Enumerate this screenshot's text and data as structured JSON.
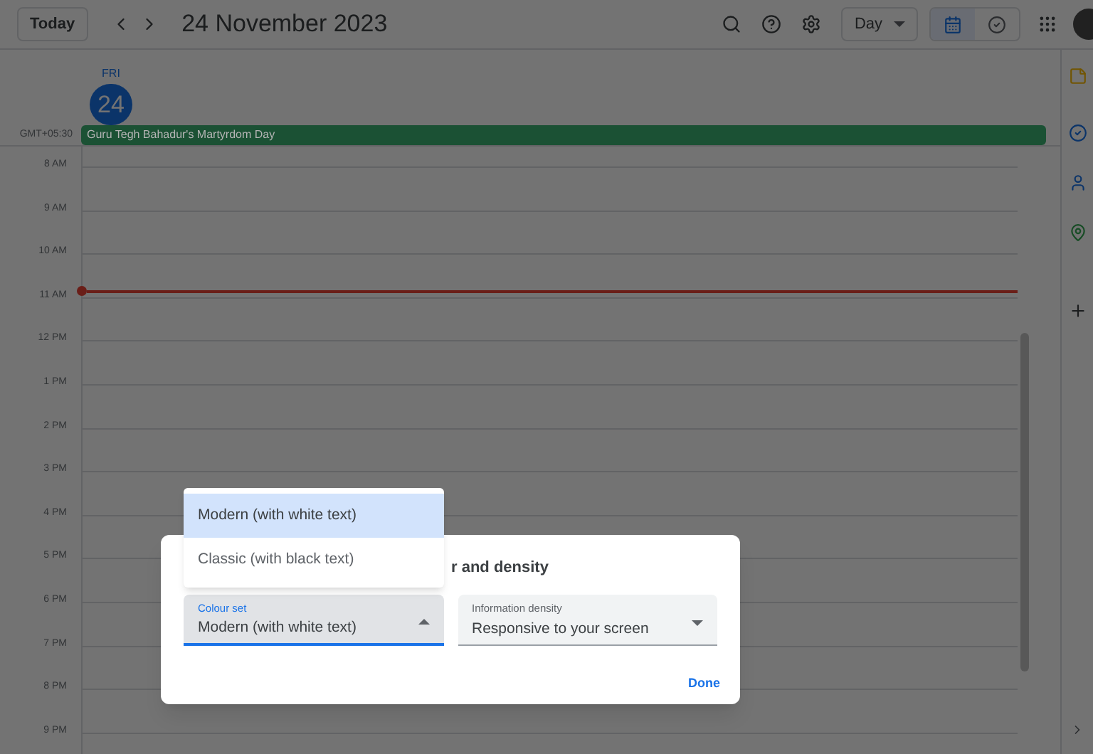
{
  "toolbar": {
    "today_button": "Today",
    "title": "24 November 2023",
    "view_dropdown": "Day",
    "view_toggle": [
      {
        "kind": "calendar",
        "selected": true
      },
      {
        "kind": "tasks",
        "selected": false
      }
    ]
  },
  "day_header": {
    "weekday": "FRI",
    "date": "24",
    "today": true
  },
  "all_day": {
    "timezone": "GMT+05:30",
    "events": [
      {
        "title": "Guru Tegh Bahadur's Martyrdom Day",
        "color": "#1b5134"
      }
    ]
  },
  "hours": [
    "8 AM",
    "9 AM",
    "10 AM",
    "11 AM",
    "12 PM",
    "1 PM",
    "2 PM",
    "3 PM",
    "4 PM",
    "5 PM",
    "6 PM",
    "7 PM",
    "8 PM",
    "9 PM"
  ],
  "dialog": {
    "title": "r and density",
    "fields": [
      {
        "label": "Colour set",
        "value": "Modern (with white text)",
        "open": true
      },
      {
        "label": "Information density",
        "value": "Responsive to your screen",
        "open": false
      }
    ],
    "done_button": "Done"
  },
  "dropdown_menu": [
    {
      "label": "Modern (with white text)",
      "selected": true
    },
    {
      "label": "Classic (with black text)",
      "selected": false
    }
  ]
}
